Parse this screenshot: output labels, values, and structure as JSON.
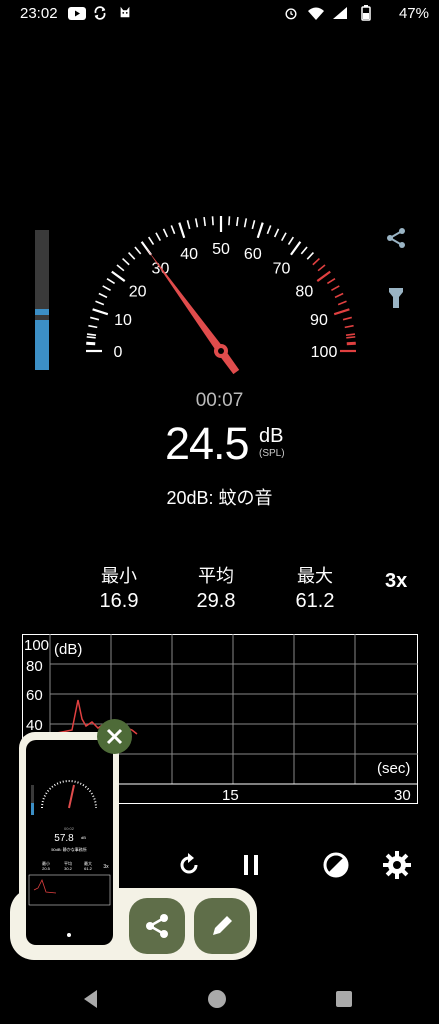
{
  "status_bar": {
    "time": "23:02",
    "battery": "47%"
  },
  "gauge": {
    "labels": [
      "0",
      "10",
      "20",
      "30",
      "40",
      "50",
      "60",
      "70",
      "80",
      "90",
      "100"
    ],
    "needle_value": 30,
    "level_fraction": 0.35
  },
  "timer": "00:07",
  "reading": {
    "value": "24.5",
    "unit": "dB",
    "sub_unit": "(SPL)"
  },
  "description": "20dB: 蚊の音",
  "stats": [
    {
      "label": "最小",
      "value": "16.9"
    },
    {
      "label": "平均",
      "value": "29.8"
    },
    {
      "label": "最大",
      "value": "61.2"
    }
  ],
  "speed": "3x",
  "graph": {
    "y_unit": "(dB)",
    "x_unit": "(sec)",
    "y_ticks": [
      "100",
      "80",
      "60",
      "40"
    ],
    "x_ticks": [
      "15",
      "30"
    ]
  },
  "thumbnail": {
    "value": "57.8",
    "unit": "dB",
    "time": "00:02",
    "desc": "50dB: 静かな事務所",
    "stats": [
      {
        "label": "最小",
        "value": "20.5"
      },
      {
        "label": "平均",
        "value": "30.2"
      },
      {
        "label": "最大",
        "value": "61.2"
      }
    ],
    "speed": "3x"
  },
  "colors": {
    "accent_red": "#e04040",
    "needle": "#e04c4c",
    "level": "#3c8fc6",
    "overlay_bg": "#f4f2e6",
    "button_green": "#5f6e49"
  }
}
